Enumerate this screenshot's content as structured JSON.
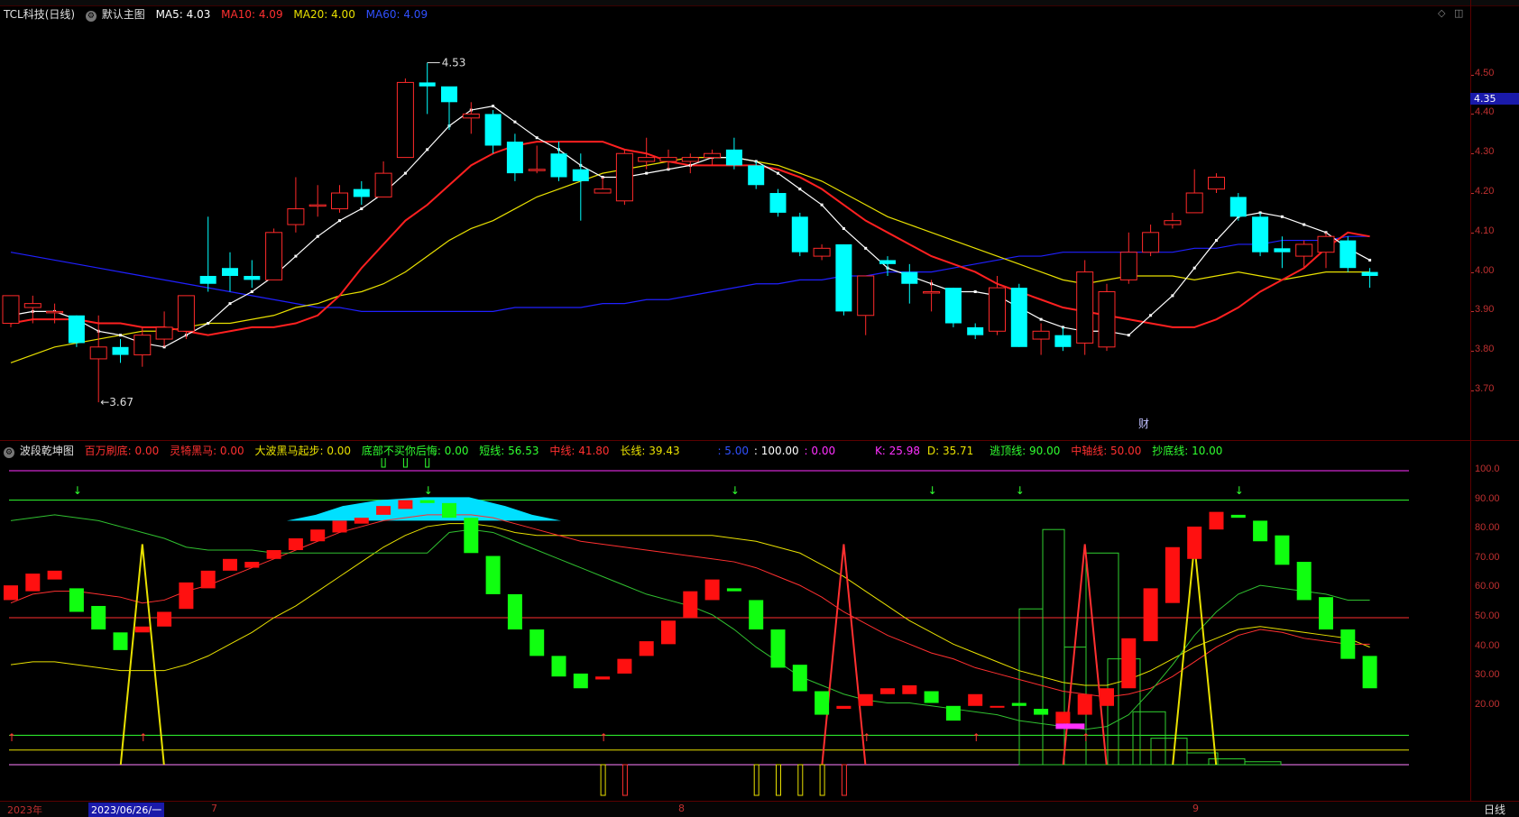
{
  "main": {
    "title": "TCL科技(日线)",
    "template": "默认主图",
    "ma5": "MA5: 4.03",
    "ma10": "MA10: 4.09",
    "ma20": "MA20: 4.00",
    "ma60": "MA60: 4.09",
    "high_label": "4.53",
    "low_label": "3.67",
    "current_price": "4.35",
    "fin_marker": "财",
    "scale": [
      "4.50",
      "4.40",
      "4.30",
      "4.20",
      "4.10",
      "4.00",
      "3.90",
      "3.80",
      "3.70"
    ]
  },
  "sub": {
    "title": "波段乾坤图",
    "v1": "百万刷底: 0.00",
    "v2": "灵犄黑马: 0.00",
    "v3": "大波黑马起步: 0.00",
    "v4": "底部不买你后悔: 0.00",
    "v5": "短线: 56.53",
    "v6": "中线: 41.80",
    "v7": "长线: 39.43",
    "v8": ": 5.00",
    "v9": ": 100.00",
    "v10": ": 0.00",
    "v11": "K: 25.98",
    "v12": "D: 35.71",
    "v13": "逃顶线: 90.00",
    "v14": "中轴线: 50.00",
    "v15": "抄底线: 10.00",
    "scale": [
      "100.0",
      "90.00",
      "80.00",
      "70.00",
      "60.00",
      "50.00",
      "40.00",
      "30.00",
      "20.00"
    ]
  },
  "timeline": {
    "year": "2023年",
    "cursor_date": "2023/06/26/一",
    "m7": "7",
    "m8": "8",
    "m9": "9",
    "period": "日线"
  },
  "colors": {
    "up": "#ff2a2a",
    "down": "#00ffff",
    "ma5": "#ffffff",
    "ma10": "#ff2020",
    "ma20": "#e8e000",
    "ma60": "#2020ff"
  },
  "chart_data": {
    "type": "candlestick",
    "title": "TCL科技(日线)",
    "ylim": [
      3.62,
      4.57
    ],
    "candles": [
      {
        "o": 3.87,
        "c": 3.94,
        "h": 3.94,
        "l": 3.86
      },
      {
        "o": 3.91,
        "c": 3.92,
        "h": 3.94,
        "l": 3.87
      },
      {
        "o": 3.9,
        "c": 3.9,
        "h": 3.92,
        "l": 3.87
      },
      {
        "o": 3.89,
        "c": 3.82,
        "h": 3.89,
        "l": 3.81
      },
      {
        "o": 3.78,
        "c": 3.81,
        "h": 3.89,
        "l": 3.67
      },
      {
        "o": 3.81,
        "c": 3.79,
        "h": 3.83,
        "l": 3.77
      },
      {
        "o": 3.79,
        "c": 3.84,
        "h": 3.86,
        "l": 3.76
      },
      {
        "o": 3.83,
        "c": 3.86,
        "h": 3.9,
        "l": 3.81
      },
      {
        "o": 3.85,
        "c": 3.94,
        "h": 3.94,
        "l": 3.83
      },
      {
        "o": 3.99,
        "c": 3.97,
        "h": 4.14,
        "l": 3.95
      },
      {
        "o": 4.01,
        "c": 3.99,
        "h": 4.05,
        "l": 3.95
      },
      {
        "o": 3.99,
        "c": 3.98,
        "h": 4.03,
        "l": 3.96
      },
      {
        "o": 3.98,
        "c": 4.1,
        "h": 4.11,
        "l": 3.98
      },
      {
        "o": 4.12,
        "c": 4.16,
        "h": 4.24,
        "l": 4.1
      },
      {
        "o": 4.17,
        "c": 4.17,
        "h": 4.22,
        "l": 4.14
      },
      {
        "o": 4.16,
        "c": 4.2,
        "h": 4.22,
        "l": 4.15
      },
      {
        "o": 4.21,
        "c": 4.19,
        "h": 4.23,
        "l": 4.17
      },
      {
        "o": 4.19,
        "c": 4.25,
        "h": 4.28,
        "l": 4.19
      },
      {
        "o": 4.29,
        "c": 4.48,
        "h": 4.49,
        "l": 4.29
      },
      {
        "o": 4.48,
        "c": 4.47,
        "h": 4.53,
        "l": 4.4
      },
      {
        "o": 4.47,
        "c": 4.43,
        "h": 4.45,
        "l": 4.36
      },
      {
        "o": 4.39,
        "c": 4.4,
        "h": 4.43,
        "l": 4.35
      },
      {
        "o": 4.4,
        "c": 4.32,
        "h": 4.41,
        "l": 4.3
      },
      {
        "o": 4.33,
        "c": 4.25,
        "h": 4.35,
        "l": 4.23
      },
      {
        "o": 4.26,
        "c": 4.26,
        "h": 4.32,
        "l": 4.25
      },
      {
        "o": 4.3,
        "c": 4.24,
        "h": 4.33,
        "l": 4.23
      },
      {
        "o": 4.26,
        "c": 4.23,
        "h": 4.3,
        "l": 4.13
      },
      {
        "o": 4.2,
        "c": 4.21,
        "h": 4.24,
        "l": 4.2
      },
      {
        "o": 4.18,
        "c": 4.3,
        "h": 4.31,
        "l": 4.17
      },
      {
        "o": 4.28,
        "c": 4.29,
        "h": 4.34,
        "l": 4.26
      },
      {
        "o": 4.28,
        "c": 4.29,
        "h": 4.31,
        "l": 4.26
      },
      {
        "o": 4.28,
        "c": 4.29,
        "h": 4.3,
        "l": 4.25
      },
      {
        "o": 4.29,
        "c": 4.3,
        "h": 4.31,
        "l": 4.27
      },
      {
        "o": 4.31,
        "c": 4.27,
        "h": 4.34,
        "l": 4.26
      },
      {
        "o": 4.27,
        "c": 4.22,
        "h": 4.28,
        "l": 4.21
      },
      {
        "o": 4.2,
        "c": 4.15,
        "h": 4.21,
        "l": 4.14
      },
      {
        "o": 4.14,
        "c": 4.05,
        "h": 4.15,
        "l": 4.04
      },
      {
        "o": 4.04,
        "c": 4.06,
        "h": 4.07,
        "l": 4.03
      },
      {
        "o": 4.07,
        "c": 3.9,
        "h": 4.07,
        "l": 3.89
      },
      {
        "o": 3.89,
        "c": 3.99,
        "h": 3.99,
        "l": 3.84
      },
      {
        "o": 4.03,
        "c": 4.02,
        "h": 4.04,
        "l": 3.99
      },
      {
        "o": 4.0,
        "c": 3.97,
        "h": 4.02,
        "l": 3.92
      },
      {
        "o": 3.95,
        "c": 3.95,
        "h": 3.98,
        "l": 3.9
      },
      {
        "o": 3.96,
        "c": 3.87,
        "h": 3.96,
        "l": 3.86
      },
      {
        "o": 3.86,
        "c": 3.84,
        "h": 3.87,
        "l": 3.83
      },
      {
        "o": 3.85,
        "c": 3.96,
        "h": 3.99,
        "l": 3.84
      },
      {
        "o": 3.96,
        "c": 3.81,
        "h": 3.97,
        "l": 3.81
      },
      {
        "o": 3.83,
        "c": 3.85,
        "h": 3.87,
        "l": 3.79
      },
      {
        "o": 3.84,
        "c": 3.81,
        "h": 3.86,
        "l": 3.8
      },
      {
        "o": 3.82,
        "c": 4.0,
        "h": 4.03,
        "l": 3.79
      },
      {
        "o": 3.81,
        "c": 3.95,
        "h": 3.97,
        "l": 3.8
      },
      {
        "o": 3.98,
        "c": 4.05,
        "h": 4.1,
        "l": 3.97
      },
      {
        "o": 4.05,
        "c": 4.1,
        "h": 4.12,
        "l": 4.04
      },
      {
        "o": 4.12,
        "c": 4.13,
        "h": 4.15,
        "l": 4.11
      },
      {
        "o": 4.15,
        "c": 4.2,
        "h": 4.26,
        "l": 4.15
      },
      {
        "o": 4.21,
        "c": 4.24,
        "h": 4.25,
        "l": 4.2
      },
      {
        "o": 4.19,
        "c": 4.14,
        "h": 4.2,
        "l": 4.13
      },
      {
        "o": 4.14,
        "c": 4.05,
        "h": 4.15,
        "l": 4.04
      },
      {
        "o": 4.06,
        "c": 4.05,
        "h": 4.09,
        "l": 4.01
      },
      {
        "o": 4.04,
        "c": 4.07,
        "h": 4.08,
        "l": 4.01
      },
      {
        "o": 4.05,
        "c": 4.09,
        "h": 4.1,
        "l": 4.01
      },
      {
        "o": 4.08,
        "c": 4.01,
        "h": 4.09,
        "l": 4.0
      },
      {
        "o": 4.0,
        "c": 3.99,
        "h": 4.01,
        "l": 3.96
      }
    ],
    "ma5": [
      3.89,
      3.9,
      3.9,
      3.88,
      3.85,
      3.84,
      3.82,
      3.81,
      3.84,
      3.87,
      3.92,
      3.95,
      3.99,
      4.04,
      4.09,
      4.13,
      4.16,
      4.2,
      4.25,
      4.31,
      4.37,
      4.41,
      4.42,
      4.38,
      4.34,
      4.31,
      4.27,
      4.24,
      4.24,
      4.25,
      4.26,
      4.27,
      4.29,
      4.29,
      4.28,
      4.25,
      4.21,
      4.17,
      4.11,
      4.06,
      4.01,
      3.99,
      3.97,
      3.95,
      3.95,
      3.94,
      3.91,
      3.88,
      3.86,
      3.85,
      3.85,
      3.84,
      3.89,
      3.94,
      4.01,
      4.08,
      4.14,
      4.15,
      4.14,
      4.12,
      4.1,
      4.06,
      4.03
    ],
    "ma10": [
      3.87,
      3.88,
      3.88,
      3.88,
      3.87,
      3.87,
      3.86,
      3.86,
      3.85,
      3.84,
      3.85,
      3.86,
      3.86,
      3.87,
      3.89,
      3.94,
      4.01,
      4.07,
      4.13,
      4.17,
      4.22,
      4.27,
      4.3,
      4.32,
      4.33,
      4.33,
      4.33,
      4.33,
      4.31,
      4.3,
      4.28,
      4.27,
      4.27,
      4.27,
      4.27,
      4.26,
      4.24,
      4.21,
      4.17,
      4.13,
      4.1,
      4.07,
      4.04,
      4.02,
      4.0,
      3.97,
      3.95,
      3.93,
      3.91,
      3.9,
      3.89,
      3.88,
      3.87,
      3.86,
      3.86,
      3.88,
      3.91,
      3.95,
      3.98,
      4.01,
      4.06,
      4.1,
      4.09
    ],
    "ma20": [
      3.77,
      3.79,
      3.81,
      3.82,
      3.83,
      3.84,
      3.85,
      3.85,
      3.86,
      3.87,
      3.87,
      3.88,
      3.89,
      3.91,
      3.92,
      3.94,
      3.95,
      3.97,
      4.0,
      4.04,
      4.08,
      4.11,
      4.13,
      4.16,
      4.19,
      4.21,
      4.23,
      4.25,
      4.26,
      4.27,
      4.28,
      4.29,
      4.29,
      4.29,
      4.28,
      4.27,
      4.25,
      4.23,
      4.2,
      4.17,
      4.14,
      4.12,
      4.1,
      4.08,
      4.06,
      4.04,
      4.02,
      4.0,
      3.98,
      3.97,
      3.98,
      3.99,
      3.99,
      3.99,
      3.98,
      3.99,
      4.0,
      3.99,
      3.98,
      3.99,
      4.0,
      4.0,
      4.0
    ],
    "ma60": [
      4.05,
      4.04,
      4.03,
      4.02,
      4.01,
      4.0,
      3.99,
      3.98,
      3.97,
      3.96,
      3.95,
      3.94,
      3.93,
      3.92,
      3.91,
      3.91,
      3.9,
      3.9,
      3.9,
      3.9,
      3.9,
      3.9,
      3.9,
      3.91,
      3.91,
      3.91,
      3.91,
      3.92,
      3.92,
      3.93,
      3.93,
      3.94,
      3.95,
      3.96,
      3.97,
      3.97,
      3.98,
      3.98,
      3.99,
      3.99,
      4.0,
      4.0,
      4.0,
      4.01,
      4.02,
      4.03,
      4.04,
      4.04,
      4.05,
      4.05,
      4.05,
      4.05,
      4.05,
      4.05,
      4.06,
      4.06,
      4.07,
      4.07,
      4.08,
      4.08,
      4.08,
      4.09,
      4.09
    ],
    "sub_ylim": [
      0,
      105
    ],
    "kd_bars": [
      {
        "o": 56,
        "c": 61
      },
      {
        "o": 59,
        "c": 65
      },
      {
        "o": 63,
        "c": 66
      },
      {
        "o": 60,
        "c": 52
      },
      {
        "o": 54,
        "c": 46
      },
      {
        "o": 45,
        "c": 39
      },
      {
        "o": 45,
        "c": 47
      },
      {
        "o": 47,
        "c": 52
      },
      {
        "o": 53,
        "c": 62
      },
      {
        "o": 60,
        "c": 66
      },
      {
        "o": 66,
        "c": 70
      },
      {
        "o": 67,
        "c": 69
      },
      {
        "o": 70,
        "c": 73
      },
      {
        "o": 73,
        "c": 77
      },
      {
        "o": 76,
        "c": 80
      },
      {
        "o": 79,
        "c": 83
      },
      {
        "o": 82,
        "c": 84
      },
      {
        "o": 85,
        "c": 88
      },
      {
        "o": 87,
        "c": 90
      },
      {
        "o": 90,
        "c": 89
      },
      {
        "o": 89,
        "c": 84
      },
      {
        "o": 84,
        "c": 72
      },
      {
        "o": 71,
        "c": 58
      },
      {
        "o": 58,
        "c": 46
      },
      {
        "o": 46,
        "c": 37
      },
      {
        "o": 37,
        "c": 30
      },
      {
        "o": 31,
        "c": 26
      },
      {
        "o": 29,
        "c": 30
      },
      {
        "o": 31,
        "c": 36
      },
      {
        "o": 37,
        "c": 42
      },
      {
        "o": 41,
        "c": 49
      },
      {
        "o": 50,
        "c": 59
      },
      {
        "o": 56,
        "c": 63
      },
      {
        "o": 60,
        "c": 59
      },
      {
        "o": 56,
        "c": 46
      },
      {
        "o": 46,
        "c": 33
      },
      {
        "o": 34,
        "c": 25
      },
      {
        "o": 25,
        "c": 17
      },
      {
        "o": 19,
        "c": 20
      },
      {
        "o": 20,
        "c": 24
      },
      {
        "o": 24,
        "c": 26
      },
      {
        "o": 24,
        "c": 27
      },
      {
        "o": 25,
        "c": 21
      },
      {
        "o": 20,
        "c": 15
      },
      {
        "o": 20,
        "c": 24
      },
      {
        "o": 20,
        "c": 20
      },
      {
        "o": 21,
        "c": 20
      },
      {
        "o": 19,
        "c": 17
      },
      {
        "o": 14,
        "c": 18
      },
      {
        "o": 17,
        "c": 24
      },
      {
        "o": 20,
        "c": 26
      },
      {
        "o": 26,
        "c": 43
      },
      {
        "o": 42,
        "c": 60
      },
      {
        "o": 55,
        "c": 74
      },
      {
        "o": 70,
        "c": 81
      },
      {
        "o": 80,
        "c": 86
      },
      {
        "o": 85,
        "c": 84
      },
      {
        "o": 83,
        "c": 76
      },
      {
        "o": 78,
        "c": 68
      },
      {
        "o": 69,
        "c": 56
      },
      {
        "o": 57,
        "c": 46
      },
      {
        "o": 46,
        "c": 36
      },
      {
        "o": 37,
        "c": 26
      }
    ],
    "short_line": [
      83,
      84,
      85,
      84,
      83,
      81,
      79,
      77,
      74,
      73,
      73,
      73,
      72,
      72,
      72,
      72,
      72,
      72,
      72,
      72,
      79,
      80,
      79,
      76,
      73,
      70,
      67,
      64,
      61,
      58,
      56,
      54,
      51,
      46,
      40,
      35,
      30,
      27,
      24,
      22,
      21,
      21,
      20,
      19,
      18,
      17,
      15,
      14,
      13,
      12,
      13,
      17,
      25,
      34,
      44,
      52,
      58,
      61,
      60,
      59,
      58,
      56,
      56
    ],
    "mid_line": [
      55,
      58,
      59,
      59,
      58,
      57,
      55,
      56,
      59,
      61,
      64,
      67,
      70,
      73,
      76,
      79,
      81,
      83,
      84,
      85,
      85,
      85,
      84,
      82,
      80,
      78,
      76,
      75,
      74,
      73,
      72,
      71,
      70,
      69,
      67,
      64,
      61,
      57,
      52,
      48,
      44,
      41,
      38,
      36,
      33,
      31,
      29,
      27,
      25,
      24,
      23,
      24,
      26,
      30,
      35,
      40,
      44,
      46,
      45,
      43,
      42,
      41,
      41
    ],
    "long_line": [
      34,
      35,
      35,
      34,
      33,
      32,
      32,
      32,
      34,
      37,
      41,
      45,
      50,
      54,
      59,
      64,
      69,
      74,
      78,
      81,
      82,
      82,
      81,
      79,
      78,
      78,
      78,
      78,
      78,
      78,
      78,
      78,
      78,
      77,
      76,
      74,
      72,
      68,
      64,
      59,
      54,
      49,
      45,
      41,
      38,
      35,
      32,
      30,
      28,
      27,
      27,
      29,
      32,
      36,
      40,
      43,
      46,
      47,
      46,
      45,
      44,
      43,
      40
    ]
  }
}
